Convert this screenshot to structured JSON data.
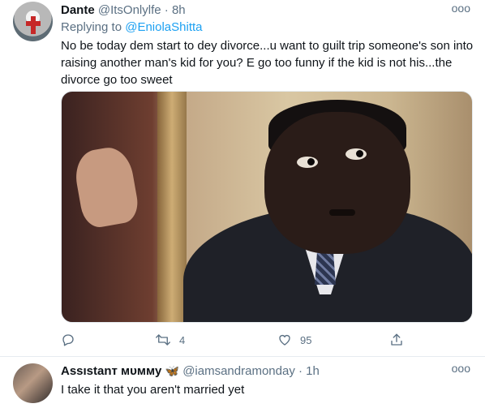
{
  "tweets": [
    {
      "name": "Dante",
      "handle": "@ItsOnlylfe",
      "separator": "·",
      "time": "8h",
      "more": "ooo",
      "replying_prefix": "Replying to ",
      "replying_to": "@EniolaShitta",
      "text": "No be today dem start to dey divorce...u want to guilt trip someone's son into raising another man's kid for you? E go too funny if the kid is not his...the divorce go too sweet",
      "media": "image",
      "actions": {
        "reply": {
          "icon": "reply-icon",
          "count": ""
        },
        "retweet": {
          "icon": "retweet-icon",
          "count": "4"
        },
        "like": {
          "icon": "heart-icon",
          "count": "95"
        },
        "share": {
          "icon": "share-icon",
          "count": ""
        }
      }
    },
    {
      "name": "Assıstanт мυммy",
      "emoji": "🦋",
      "handle": "@iamsandramonday",
      "separator": "·",
      "time": "1h",
      "more": "ooo",
      "text": "I take it that you aren't married yet"
    }
  ],
  "colors": {
    "accent": "#1da1f2",
    "secondary_text": "#5b7083",
    "divider": "#e6ecf0"
  }
}
